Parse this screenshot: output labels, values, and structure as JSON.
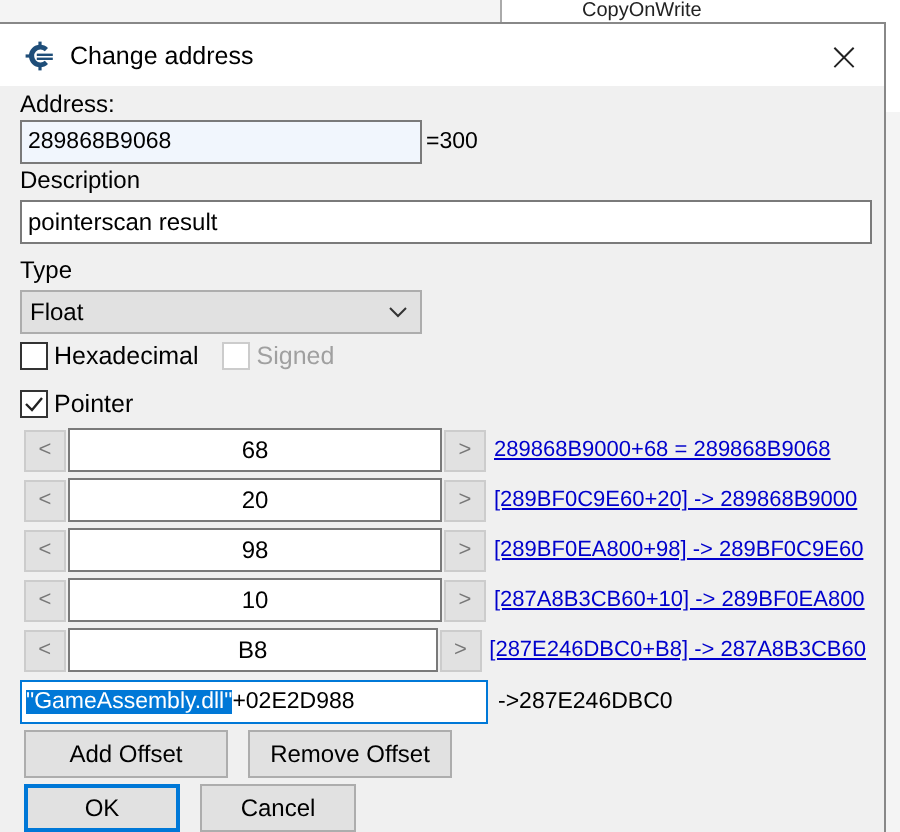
{
  "background_window": {
    "text": "CopyOnWrite"
  },
  "window": {
    "title": "Change address",
    "close": "×"
  },
  "address": {
    "label": "Address:",
    "value": "289868B9068",
    "result": "=300"
  },
  "description": {
    "label": "Description",
    "value": "pointerscan result"
  },
  "type": {
    "label": "Type",
    "value": "Float"
  },
  "options": [
    {
      "label": "Hexadecimal",
      "checked": false,
      "disabled": false
    },
    {
      "label": "Signed",
      "checked": false,
      "disabled": true
    }
  ],
  "pointer": {
    "label": "Pointer",
    "checked": true
  },
  "offsets": [
    {
      "dec": "<",
      "value": "68",
      "inc": ">",
      "link": "289868B9000+68 = 289868B9068"
    },
    {
      "dec": "<",
      "value": "20",
      "inc": ">",
      "link": "[289BF0C9E60+20] -> 289868B9000"
    },
    {
      "dec": "<",
      "value": "98",
      "inc": ">",
      "link": "[289BF0EA800+98] -> 289BF0C9E60"
    },
    {
      "dec": "<",
      "value": "10",
      "inc": ">",
      "link": "[287A8B3CB60+10] -> 289BF0EA800"
    },
    {
      "dec": "<",
      "value": "B8",
      "inc": ">",
      "link": "[287E246DBC0+B8] -> 287A8B3CB60"
    }
  ],
  "base": {
    "selected_part": "\"GameAssembly.dll\"",
    "rest": "+02E2D988",
    "result": "->287E246DBC0"
  },
  "offset_buttons": [
    "Add Offset",
    "Remove Offset"
  ],
  "buttons": [
    {
      "label": "OK",
      "default": true
    },
    {
      "label": "Cancel",
      "default": false
    }
  ]
}
